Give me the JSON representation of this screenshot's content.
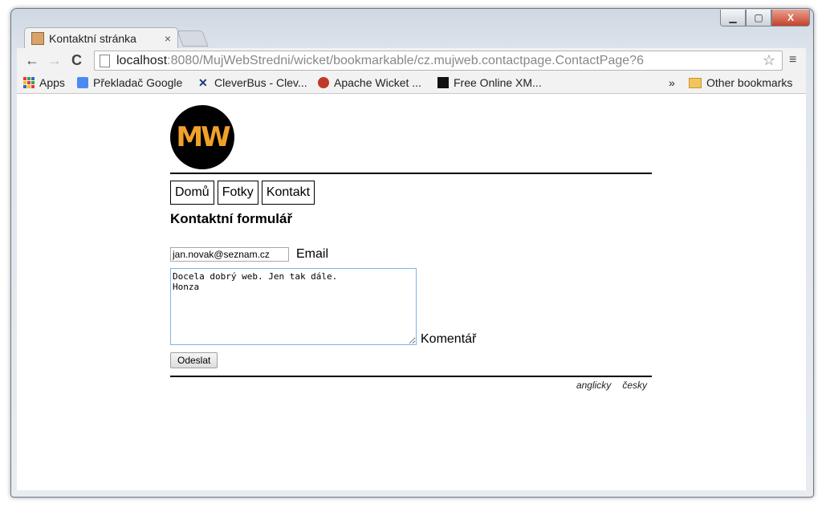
{
  "window": {
    "controls": {
      "minimize": "▁",
      "maximize": "▢",
      "close": "X"
    }
  },
  "tab": {
    "title": "Kontaktní stránka",
    "close": "×"
  },
  "toolbar": {
    "back": "←",
    "forward": "→",
    "reload": "C",
    "url_host": "localhost",
    "url_rest": ":8080/MujWebStredni/wicket/bookmarkable/cz.mujweb.contactpage.ContactPage?6",
    "star": "☆",
    "menu": "≡"
  },
  "bookmarks": {
    "items": [
      "Apps",
      "Překladač Google",
      "CleverBus - Clev...",
      "Apache Wicket ...",
      "Free Online XM..."
    ],
    "overflow": "»",
    "other": "Other bookmarks"
  },
  "page": {
    "logo": "MW",
    "nav": [
      "Domů",
      "Fotky",
      "Kontakt"
    ],
    "heading": "Kontaktní formulář",
    "email_value": "jan.novak@seznam.cz",
    "email_label": "Email",
    "comment_value": "Docela dobrý web. Jen tak dále.\nHonza",
    "comment_label": "Komentář",
    "submit": "Odeslat",
    "languages": [
      "anglicky",
      "česky"
    ]
  },
  "colors": {
    "logo_bg": "#000000",
    "logo_text": "#f0a12a",
    "textarea_border": "#7eb4e6"
  }
}
